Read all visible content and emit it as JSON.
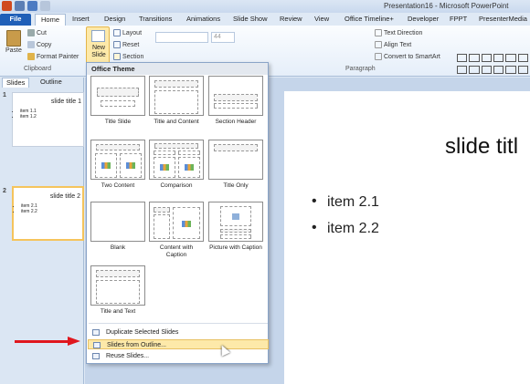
{
  "window": {
    "title": "Presentation16 - Microsoft PowerPoint"
  },
  "tabs": [
    "File",
    "Home",
    "Insert",
    "Design",
    "Transitions",
    "Animations",
    "Slide Show",
    "Review",
    "View",
    "Office Timeline+",
    "Developer",
    "FPPT",
    "PresenterMedia"
  ],
  "ribbon": {
    "paste": "Paste",
    "cut": "Cut",
    "copy": "Copy",
    "format_painter": "Format Painter",
    "clipboard_group": "Clipboard",
    "new_slide": "New Slide",
    "layout": "Layout",
    "reset": "Reset",
    "section": "Section",
    "font_size": "44",
    "text_direction": "Text Direction",
    "align_text": "Align Text",
    "convert_smartart": "Convert to SmartArt",
    "paragraph_group": "Paragraph"
  },
  "left_pane": {
    "tabs": [
      "Slides",
      "Outline"
    ],
    "thumbnails": [
      {
        "number": "1",
        "title": "slide title 1",
        "items": [
          "item 1.1",
          "item 1.2"
        ]
      },
      {
        "number": "2",
        "title": "slide title 2",
        "items": [
          "item 2.1",
          "item 2.2"
        ]
      }
    ]
  },
  "slide": {
    "title": "slide titl",
    "bullets": [
      "item 2.1",
      "item 2.2"
    ]
  },
  "dropdown": {
    "header": "Office Theme",
    "layouts": [
      "Title Slide",
      "Title and Content",
      "Section Header",
      "Two Content",
      "Comparison",
      "Title Only",
      "Blank",
      "Content with Caption",
      "Picture with Caption",
      "Title and Text"
    ],
    "commands": [
      "Duplicate Selected Slides",
      "Slides from Outline...",
      "Reuse Slides..."
    ]
  },
  "colors": {
    "file_tab": "#1f5fb8",
    "hover": "#fde9a9",
    "arrow": "#e0171e"
  }
}
